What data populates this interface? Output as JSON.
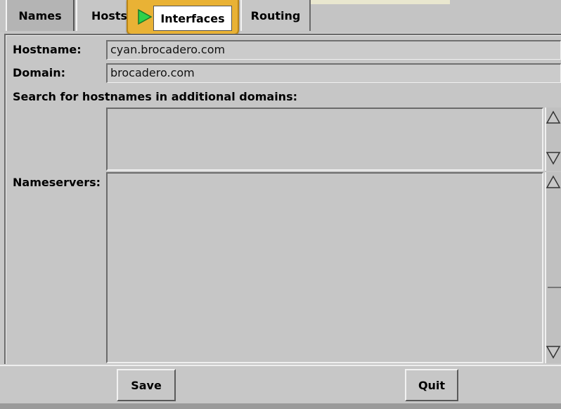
{
  "tabs": {
    "names": "Names",
    "hosts": "Hosts",
    "interfaces": "Interfaces",
    "routing": "Routing"
  },
  "form": {
    "hostname_label": "Hostname:",
    "hostname_value": "cyan.brocadero.com",
    "domain_label": "Domain:",
    "domain_value": "brocadero.com",
    "search_label": "Search for hostnames in additional domains:",
    "search_value": "",
    "nameservers_label": "Nameservers:",
    "nameservers_value": ""
  },
  "buttons": {
    "save": "Save",
    "quit": "Quit"
  },
  "icons": {
    "interfaces_tab": "play-icon",
    "scroll_up": "arrow-up-icon",
    "scroll_down": "arrow-down-icon"
  },
  "colors": {
    "highlight": "#e9b235",
    "play": "#2fd14a"
  }
}
